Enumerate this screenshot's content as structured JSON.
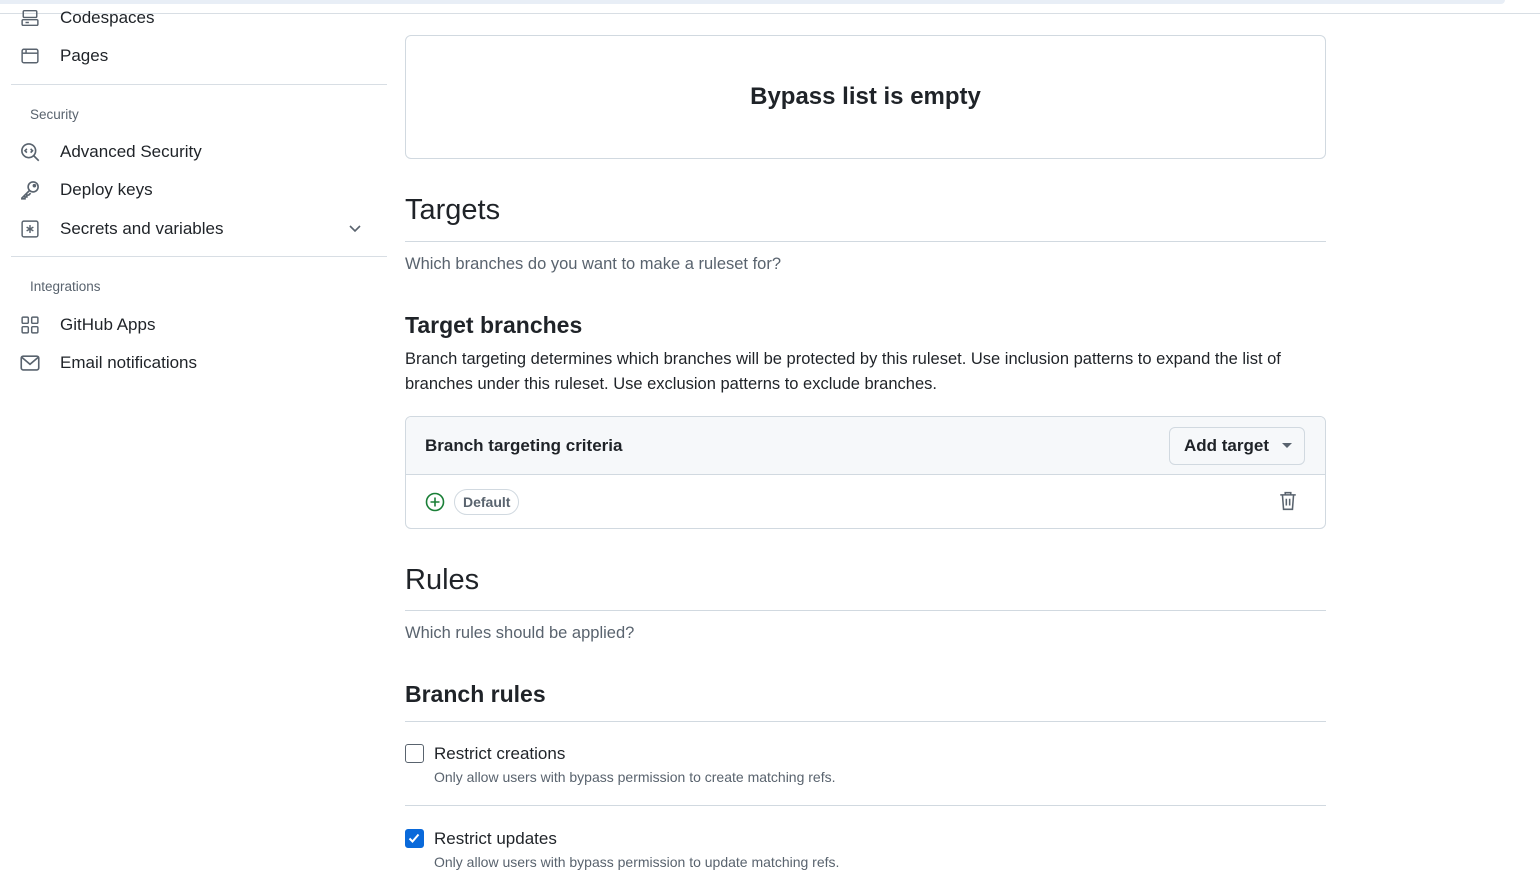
{
  "sidebar": {
    "top_items": [
      {
        "label": "Codespaces",
        "icon": "codespaces-icon"
      },
      {
        "label": "Pages",
        "icon": "browser-icon"
      }
    ],
    "security_heading": "Security",
    "security_items": [
      {
        "label": "Advanced Security",
        "icon": "codescan-icon"
      },
      {
        "label": "Deploy keys",
        "icon": "key-icon"
      },
      {
        "label": "Secrets and variables",
        "icon": "asterisk-icon",
        "expandable": true
      }
    ],
    "integrations_heading": "Integrations",
    "integrations_items": [
      {
        "label": "GitHub Apps",
        "icon": "apps-icon"
      },
      {
        "label": "Email notifications",
        "icon": "mail-icon"
      }
    ]
  },
  "main": {
    "bypass_empty": "Bypass list is empty",
    "targets": {
      "heading": "Targets",
      "subtitle": "Which branches do you want to make a ruleset for?",
      "target_branches_heading": "Target branches",
      "target_branches_desc": "Branch targeting determines which branches will be protected by this ruleset. Use inclusion patterns to expand the list of branches under this ruleset. Use exclusion patterns to exclude branches.",
      "criteria_title": "Branch targeting criteria",
      "add_target_label": "Add target",
      "criteria_items": [
        {
          "label": "Default",
          "type": "include"
        }
      ]
    },
    "rules": {
      "heading": "Rules",
      "subtitle": "Which rules should be applied?",
      "branch_rules_heading": "Branch rules",
      "items": [
        {
          "title": "Restrict creations",
          "desc": "Only allow users with bypass permission to create matching refs.",
          "checked": false
        },
        {
          "title": "Restrict updates",
          "desc": "Only allow users with bypass permission to update matching refs.",
          "checked": true
        }
      ]
    }
  },
  "colors": {
    "accent": "#0969da",
    "success": "#1a7f37",
    "muted": "#59636e",
    "border": "#d1d9e0"
  }
}
